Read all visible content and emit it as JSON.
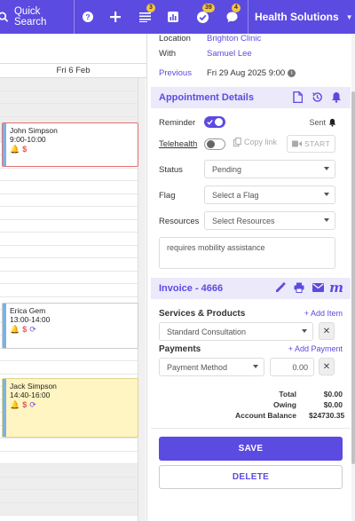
{
  "topbar": {
    "quick_search": "Quick Search",
    "badges": {
      "tasks": "3",
      "checks": "39",
      "messages": "4"
    },
    "organization": "Health Solutions"
  },
  "calendar": {
    "day_header": "Fri 6 Feb",
    "appointments": [
      {
        "name": "John Simpson",
        "time": "9:00-10:00",
        "bar_color": "#7ab3e6",
        "icons": [
          "bell-icon",
          "dollar-icon"
        ]
      },
      {
        "name": "Erica Gem",
        "time": "13:00-14:00",
        "bar_color": "#7ab3e6",
        "icons": [
          "bell-icon",
          "dollar-icon",
          "repeat-icon"
        ]
      },
      {
        "name": "Jack Simpson",
        "time": "14:40-16:00",
        "bar_color": "#7ab3e6",
        "icons": [
          "bell-icon",
          "dollar-icon",
          "repeat-icon"
        ]
      }
    ]
  },
  "details": {
    "location_label": "Location",
    "location_value": "Brighton Clinic",
    "with_label": "With",
    "with_value": "Samuel Lee",
    "previous_label": "Previous",
    "previous_value": "Fri 29 Aug 2025 9:00"
  },
  "appointment_details": {
    "title": "Appointment Details",
    "reminder_label": "Reminder",
    "reminder_on": true,
    "sent_label": "Sent",
    "telehealth_label": "Telehealth",
    "copy_link_label": "Copy link",
    "start_label": "START",
    "status_label": "Status",
    "status_value": "Pending",
    "flag_label": "Flag",
    "flag_value": "Select a Flag",
    "resources_label": "Resources",
    "resources_value": "Select Resources",
    "note": "requires mobility assistance"
  },
  "invoice": {
    "title": "Invoice - 4666",
    "services_label": "Services & Products",
    "add_item": "+ Add Item",
    "service_value": "Standard Consultation",
    "payments_label": "Payments",
    "add_payment": "+ Add Payment",
    "payment_method": "Payment Method",
    "payment_amount": "0.00",
    "total_label": "Total",
    "total_value": "$0.00",
    "owing_label": "Owing",
    "owing_value": "$0.00",
    "balance_label": "Account Balance",
    "balance_value": "$24730.35"
  },
  "actions": {
    "save": "SAVE",
    "delete": "DELETE"
  },
  "colors": {
    "accent": "#5b4be0",
    "alert": "#e05555",
    "highlight": "#fff5c2"
  }
}
